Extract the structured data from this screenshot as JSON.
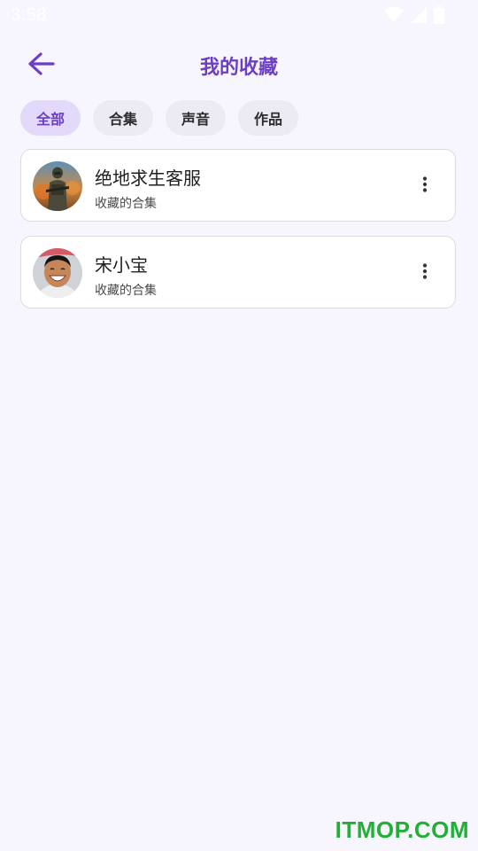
{
  "status_bar": {
    "time": "3:58",
    "icons": [
      "wifi-icon",
      "cellular-signal-icon",
      "battery-icon"
    ]
  },
  "header": {
    "back_icon": "arrow-left-icon",
    "title": "我的收藏"
  },
  "filters": {
    "chips": [
      {
        "label": "全部",
        "active": true
      },
      {
        "label": "合集",
        "active": false
      },
      {
        "label": "声音",
        "active": false
      },
      {
        "label": "作品",
        "active": false
      }
    ]
  },
  "collections": [
    {
      "title": "绝地求生客服",
      "subtitle": "收藏的合集",
      "avatar": "game-character-avatar",
      "more_icon": "more-vertical-icon"
    },
    {
      "title": "宋小宝",
      "subtitle": "收藏的合集",
      "avatar": "person-avatar",
      "more_icon": "more-vertical-icon"
    }
  ],
  "colors": {
    "accent": "#6a3fc4",
    "background": "#f7f5fd",
    "chip_active_bg": "#e2d9fb",
    "chip_bg": "#ecebf3",
    "watermark": "#1fb035"
  },
  "watermark": "ITMOP.COM"
}
